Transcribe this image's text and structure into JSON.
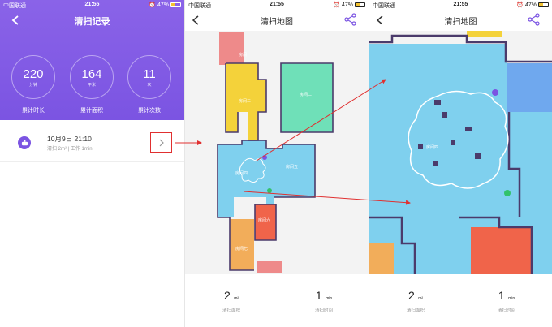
{
  "status_bar": {
    "carrier": "中国联通",
    "time": "21:55",
    "battery": "47%",
    "battery_level": 0.47
  },
  "panel1": {
    "title": "清扫记录",
    "stats": [
      {
        "value": "220",
        "unit": "分钟",
        "label": "累计时长"
      },
      {
        "value": "164",
        "unit": "平米",
        "label": "累计面积"
      },
      {
        "value": "11",
        "unit": "次",
        "label": "累计次数"
      }
    ],
    "record": {
      "date": "10月9日 21:10",
      "detail": "清扫 2m² | 工作 1min"
    }
  },
  "map_screen": {
    "title": "清扫地图",
    "rooms": [
      "房间一",
      "房间二",
      "房间三",
      "房间五",
      "房间六",
      "房间七",
      "房间四"
    ],
    "area_value": "2",
    "area_unit": "m²",
    "area_label": "清扫面积",
    "time_value": "1",
    "time_unit": "min",
    "time_label": "清扫时间"
  },
  "colors": {
    "accent": "#7b54e2",
    "annotation": "#e03030",
    "room_pink": "#ee8a8a",
    "room_yellow": "#f4d23a",
    "room_green": "#6fe0b8",
    "room_blue": "#7fd0ee",
    "room_orange": "#f2ad5a",
    "room_red": "#f0644a"
  },
  "icons": [
    "back-icon",
    "share-icon",
    "robot-icon",
    "chevron-right-icon",
    "wifi-icon",
    "alarm-icon"
  ]
}
